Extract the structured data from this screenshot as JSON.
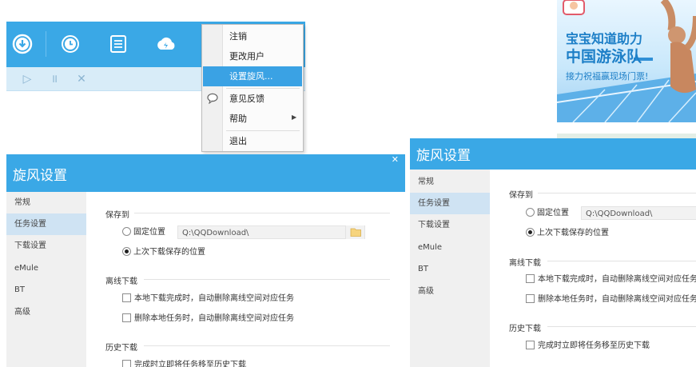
{
  "app": {
    "toolbar": {
      "icons": [
        "download-icon",
        "history-icon",
        "list-icon",
        "cloud-icon"
      ],
      "sub_icons": [
        "play-icon",
        "pause-icon",
        "close-icon"
      ]
    },
    "context_menu": {
      "items": [
        {
          "label": "注销"
        },
        {
          "label": "更改用户"
        },
        {
          "label": "设置旋风..."
        },
        {
          "label": "意见反馈"
        },
        {
          "label": "帮助"
        },
        {
          "label": "退出"
        }
      ]
    }
  },
  "ad": {
    "headline_1": "宝宝知道助力",
    "headline_2": "中国游泳队",
    "subline": "接力祝福赢现场门票!"
  },
  "dialog_left": {
    "title": "旋风设置",
    "nav": [
      "常规",
      "任务设置",
      "下载设置",
      "eMule",
      "BT",
      "高级"
    ],
    "save_section": "保存到",
    "fixed_location": "固定位置",
    "path": "Q:\\QQDownload\\",
    "last_location": "上次下载保存的位置",
    "offline_section": "离线下载",
    "offline_opt_1": "本地下载完成时，自动删除离线空间对应任务",
    "offline_opt_2": "删除本地任务时，自动删除离线空间对应任务",
    "history_section": "历史下载",
    "history_opt": "完成时立即将任务移至历史下载"
  },
  "dialog_right": {
    "title": "旋风设置",
    "nav": [
      "常规",
      "任务设置",
      "下载设置",
      "eMule",
      "BT",
      "高级"
    ],
    "save_section": "保存到",
    "fixed_location": "固定位置",
    "path": "Q:\\QQDownload\\",
    "last_location": "上次下载保存的位置",
    "offline_section": "离线下载",
    "offline_opt_1": "本地下载完成时，自动删除离线空间对应任务",
    "offline_opt_2": "删除本地任务时，自动删除离线空间对应任务",
    "history_section": "历史下载",
    "history_opt": "完成时立即将任务移至历史下载"
  },
  "colors": {
    "accent": "#3aa8e6",
    "menu_highlight": "#3aa2e4",
    "nav_selected": "#cfe3f3",
    "sidebar": "#f0f0f0"
  }
}
